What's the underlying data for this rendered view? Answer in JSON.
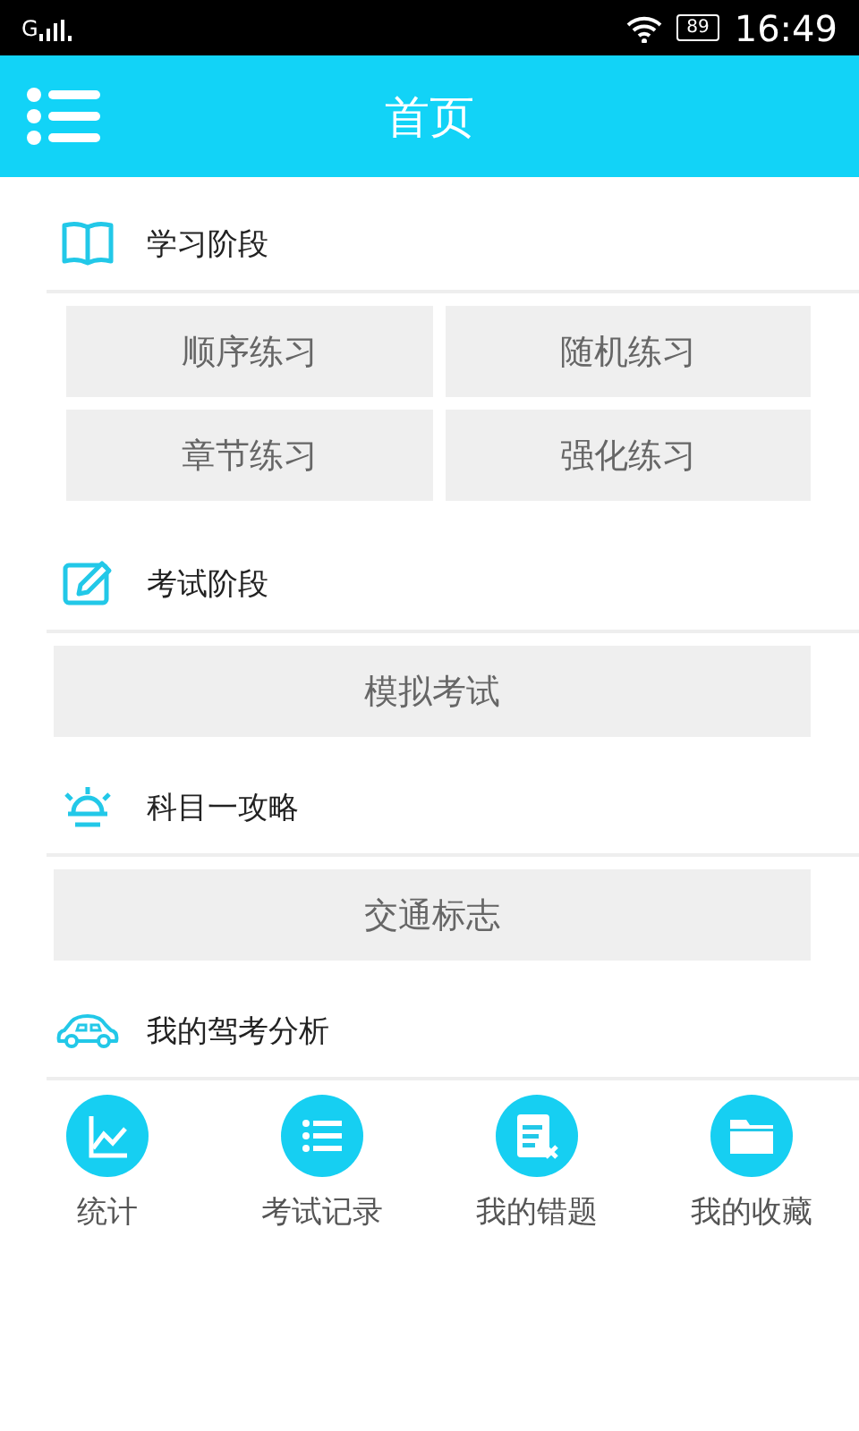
{
  "status_bar": {
    "network": "G",
    "battery": "89",
    "time": "16:49"
  },
  "app_bar": {
    "title": "首页"
  },
  "sections": [
    {
      "title": "学习阶段",
      "buttons": [
        "顺序练习",
        "随机练习",
        "章节练习",
        "强化练习"
      ]
    },
    {
      "title": "考试阶段",
      "buttons": [
        "模拟考试"
      ]
    },
    {
      "title": "科目一攻略",
      "buttons": [
        "交通标志"
      ]
    },
    {
      "title": "我的驾考分析"
    }
  ],
  "shortcuts": [
    {
      "label": "统计"
    },
    {
      "label": "考试记录"
    },
    {
      "label": "我的错题"
    },
    {
      "label": "我的收藏"
    }
  ]
}
